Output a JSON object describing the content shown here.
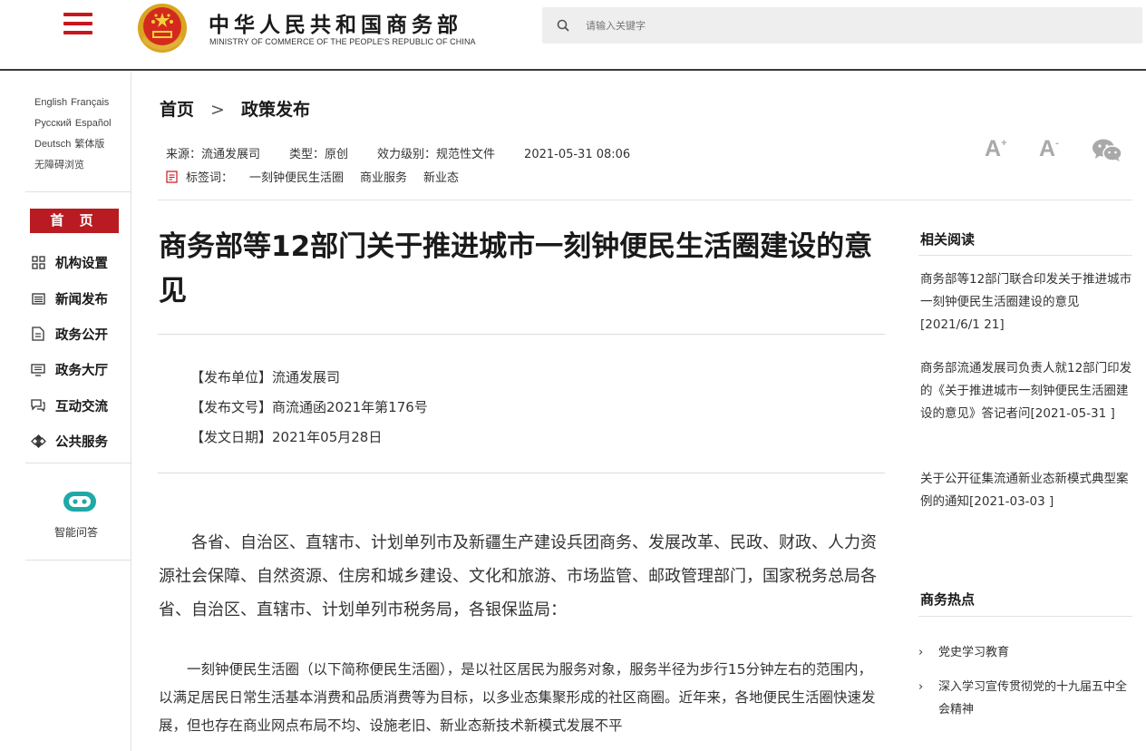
{
  "header": {
    "logo_cn": "中华人民共和国商务部",
    "logo_en": "MINISTRY OF COMMERCE OF THE PEOPLE'S REPUBLIC OF CHINA",
    "search_placeholder": "请输入关键字",
    "brand_red": "#c8171d"
  },
  "sidebar": {
    "languages": [
      [
        "English",
        "Français"
      ],
      [
        "Русский",
        "Español"
      ],
      [
        "Deutsch",
        "繁体版"
      ],
      [
        "无障碍浏览"
      ]
    ],
    "home_label": "首 页",
    "nav_items": [
      {
        "label": "机构设置",
        "icon": "org-grid-icon"
      },
      {
        "label": "新闻发布",
        "icon": "news-icon"
      },
      {
        "label": "政务公开",
        "icon": "document-icon"
      },
      {
        "label": "政务大厅",
        "icon": "monitor-icon"
      },
      {
        "label": "互动交流",
        "icon": "chat-icon"
      },
      {
        "label": "公共服务",
        "icon": "service-icon"
      }
    ],
    "qa_label": "智能问答"
  },
  "breadcrumb": {
    "home": "首页",
    "separator": ">",
    "current": "政策发布"
  },
  "meta": {
    "source": "来源：流通发展司",
    "type": "类型：原创",
    "level": "效力级别：规范性文件",
    "datetime": "2021-05-31 08:06",
    "tags_label": "标签词：",
    "tags": [
      "一刻钟便民生活圈",
      "商业服务",
      "新业态"
    ]
  },
  "tools": {
    "font_larger": "A",
    "font_smaller": "A",
    "font_larger_mark": "+",
    "font_smaller_mark": "-"
  },
  "article": {
    "title": "商务部等12部门关于推进城市一刻钟便民生活圈建设的意见",
    "issuer": "【发布单位】流通发展司",
    "doc_no": "【发布文号】商流通函2021年第176号",
    "date": "【发文日期】2021年05月28日",
    "para1": "各省、自治区、直辖市、计划单列市及新疆生产建设兵团商务、发展改革、民政、财政、人力资源社会保障、自然资源、住房和城乡建设、文化和旅游、市场监管、邮政管理部门，国家税务总局各省、自治区、直辖市、计划单列市税务局，各银保监局：",
    "para2": "一刻钟便民生活圈（以下简称便民生活圈），是以社区居民为服务对象，服务半径为步行15分钟左右的范围内，以满足居民日常生活基本消费和品质消费等为目标，以多业态集聚形成的社区商圈。近年来，各地便民生活圈快速发展，但也存在商业网点布局不均、设施老旧、新业态新技术新模式发展不平"
  },
  "related": {
    "heading": "相关阅读",
    "items": [
      "商务部等12部门联合印发关于推进城市一刻钟便民生活圈建设的意见[2021/6/1 21]",
      "商务部流通发展司负责人就12部门印发的《关于推进城市一刻钟便民生活圈建设的意见》答记者问[2021-05-31 ]",
      "关于公开征集流通新业态新模式典型案例的通知[2021-03-03 ]"
    ]
  },
  "hot": {
    "heading": "商务热点",
    "items": [
      "党史学习教育",
      "深入学习宣传贯彻党的十九届五中全会精神"
    ]
  }
}
